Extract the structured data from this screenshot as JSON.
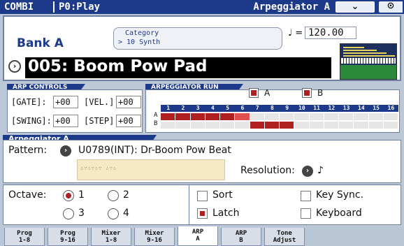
{
  "topbar": {
    "mode": "COMBI",
    "page": "P0:Play",
    "page_name": "Arpeggiator A",
    "dropdown": "✓",
    "lock": "⊙"
  },
  "header": {
    "bank": "Bank A",
    "category_label": "Category",
    "category_value": "> 10 Synth",
    "tempo_symbol": "♩ =",
    "tempo": "120.00",
    "program_icon": "›",
    "program_name": "005: Boom Pow Pad"
  },
  "arp_controls": {
    "title": "ARP CONTROLS",
    "gate_label": "[GATE]:",
    "gate_value": "+00",
    "vel_label": "[VEL.]:",
    "vel_value": "+00",
    "swing_label": "[SWING]:",
    "swing_value": "+00",
    "step_label": "[STEP]:",
    "step_value": "+00"
  },
  "arp_run": {
    "title": "ARPEGGIATOR RUN",
    "a_label": "A",
    "b_label": "B",
    "a_checked": true,
    "b_checked": true,
    "row_a": "A",
    "row_b": "B",
    "steps": [
      "1",
      "2",
      "3",
      "4",
      "5",
      "6",
      "7",
      "8",
      "9",
      "10",
      "11",
      "12",
      "13",
      "14",
      "15",
      "16"
    ],
    "current_step": 6,
    "a_range": [
      1,
      6
    ],
    "b_range": [
      7,
      9
    ]
  },
  "arpeggiator_a": {
    "title": "Arpeggiator A",
    "pattern_label": "Pattern:",
    "pattern_value": "U0789(INT): Dr-Boom Pow Beat",
    "resolution_label": "Resolution:",
    "resolution_value": "♪"
  },
  "options": {
    "octave_label": "Octave:",
    "octaves": [
      "1",
      "2",
      "3",
      "4"
    ],
    "octave_selected": "1",
    "sort_label": "Sort",
    "sort_checked": false,
    "latch_label": "Latch",
    "latch_checked": true,
    "keysync_label": "Key Sync.",
    "keysync_checked": false,
    "keyboard_label": "Keyboard",
    "keyboard_checked": false
  },
  "tabs": [
    {
      "l1": "Prog",
      "l2": "1-8"
    },
    {
      "l1": "Prog",
      "l2": "9-16"
    },
    {
      "l1": "Mixer",
      "l2": "1-8"
    },
    {
      "l1": "Mixer",
      "l2": "9-16"
    },
    {
      "l1": "ARP",
      "l2": "A"
    },
    {
      "l1": "ARP",
      "l2": "B"
    },
    {
      "l1": "Tone",
      "l2": "Adjust"
    }
  ],
  "active_tab": 4,
  "colors": {
    "accent": "#1d3a8a",
    "on": "#b02020",
    "active_step": "#e05050"
  }
}
